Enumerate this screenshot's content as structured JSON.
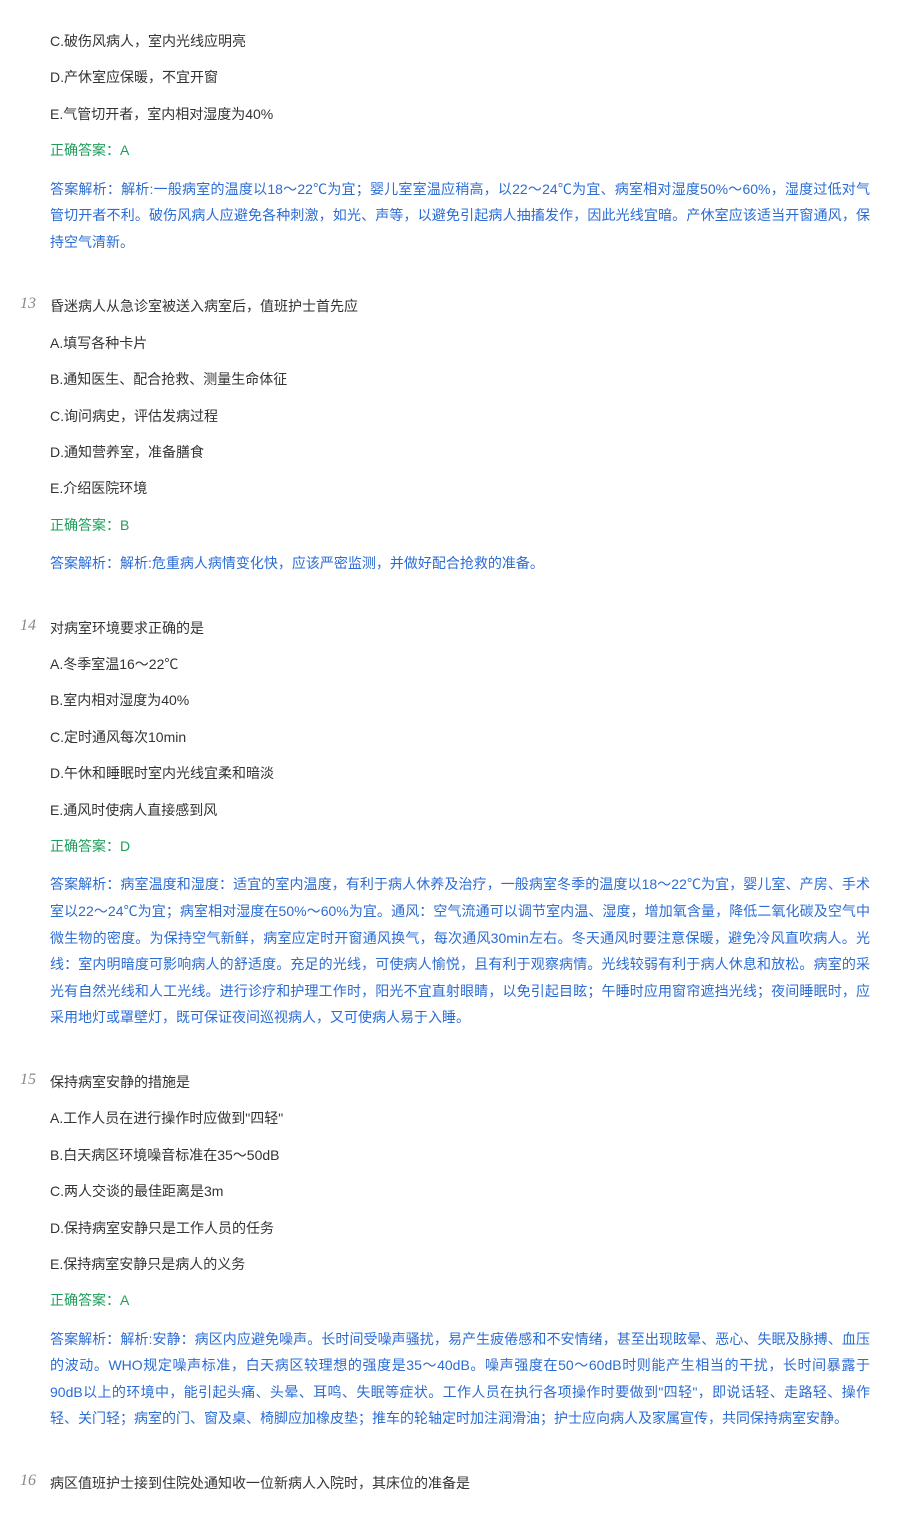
{
  "q12_continuation": {
    "opt_c": "C.破伤风病人，室内光线应明亮",
    "opt_d": "D.产休室应保暖，不宜开窗",
    "opt_e": "E.气管切开者，室内相对湿度为40%",
    "correct": "正确答案：A",
    "explain": "答案解析：解析:一般病室的温度以18～22℃为宜；婴儿室室温应稍高，以22～24℃为宜、病室相对湿度50%～60%，湿度过低对气管切开者不利。破伤风病人应避免各种刺激，如光、声等，以避免引起病人抽搐发作，因此光线宜暗。产休室应该适当开窗通风，保持空气清新。"
  },
  "q13": {
    "num": "13",
    "stem": "昏迷病人从急诊室被送入病室后，值班护士首先应",
    "opt_a": "A.填写各种卡片",
    "opt_b": "B.通知医生、配合抢救、测量生命体征",
    "opt_c": "C.询问病史，评估发病过程",
    "opt_d": "D.通知营养室，准备膳食",
    "opt_e": "E.介绍医院环境",
    "correct": "正确答案：B",
    "explain": "答案解析：解析:危重病人病情变化快，应该严密监测，并做好配合抢救的准备。"
  },
  "q14": {
    "num": "14",
    "stem": "对病室环境要求正确的是",
    "opt_a": "A.冬季室温16～22℃",
    "opt_b": "B.室内相对湿度为40%",
    "opt_c": "C.定时通风每次10min",
    "opt_d": "D.午休和睡眠时室内光线宜柔和暗淡",
    "opt_e": "E.通风时使病人直接感到风",
    "correct": "正确答案：D",
    "explain": "答案解析：病室温度和湿度：适宜的室内温度，有利于病人休养及治疗，一般病室冬季的温度以18～22℃为宜，婴儿室、产房、手术室以22～24℃为宜；病室相对湿度在50%～60%为宜。通风：空气流通可以调节室内温、湿度，增加氧含量，降低二氧化碳及空气中微生物的密度。为保持空气新鲜，病室应定时开窗通风换气，每次通风30min左右。冬天通风时要注意保暖，避免冷风直吹病人。光线：室内明暗度可影响病人的舒适度。充足的光线，可使病人愉悦，且有利于观察病情。光线较弱有利于病人休息和放松。病室的采光有自然光线和人工光线。进行诊疗和护理工作时，阳光不宜直射眼睛，以免引起目眩；午睡时应用窗帘遮挡光线；夜间睡眠时，应采用地灯或罩壁灯，既可保证夜间巡视病人，又可使病人易于入睡。"
  },
  "q15": {
    "num": "15",
    "stem": "保持病室安静的措施是",
    "opt_a": "A.工作人员在进行操作时应做到\"四轻\"",
    "opt_b": "B.白天病区环境噪音标准在35～50dB",
    "opt_c": "C.两人交谈的最佳距离是3m",
    "opt_d": "D.保持病室安静只是工作人员的任务",
    "opt_e": "E.保持病室安静只是病人的义务",
    "correct": "正确答案：A",
    "explain": "答案解析：解析:安静：病区内应避免噪声。长时间受噪声骚扰，易产生疲倦感和不安情绪，甚至出现眩晕、恶心、失眠及脉搏、血压的波动。WHO规定噪声标准，白天病区较理想的强度是35～40dB。噪声强度在50～60dB时则能产生相当的干扰，长时间暴露于90dB以上的环境中，能引起头痛、头晕、耳鸣、失眠等症状。工作人员在执行各项操作时要做到\"四轻\"，即说话轻、走路轻、操作轻、关门轻；病室的门、窗及桌、椅脚应加橡皮垫；推车的轮轴定时加注润滑油；护士应向病人及家属宣传，共同保持病室安静。"
  },
  "q16": {
    "num": "16",
    "stem": "病区值班护士接到住院处通知收一位新病人入院时，其床位的准备是"
  }
}
